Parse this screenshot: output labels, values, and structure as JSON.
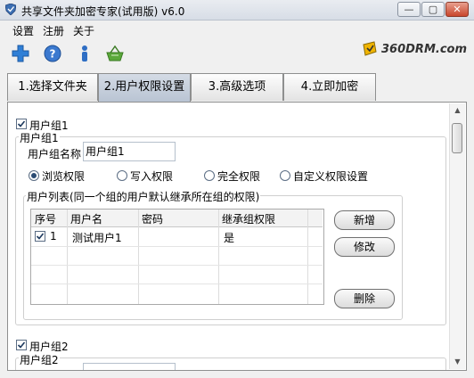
{
  "window": {
    "title": "共享文件夹加密专家(试用版) v6.0",
    "buttons": {
      "minimize": "—",
      "maximize": "▢",
      "close": "✕"
    }
  },
  "menu": [
    "设置",
    "注册",
    "关于"
  ],
  "toolbar": {
    "icons": [
      "plus-icon",
      "help-icon",
      "info-icon",
      "basket-icon"
    ],
    "brand": "360DRM.com"
  },
  "tabs": [
    {
      "label": "1.选择文件夹",
      "active": false
    },
    {
      "label": "2.用户权限设置",
      "active": true
    },
    {
      "label": "3.高级选项",
      "active": false
    },
    {
      "label": "4.立即加密",
      "active": false
    }
  ],
  "group1": {
    "checkbox_label": "用户组1",
    "checked": true,
    "frame_label": "用户组1",
    "name_label": "用户组名称",
    "name_value": "用户组1",
    "permissions": [
      "浏览权限",
      "写入权限",
      "完全权限",
      "自定义权限设置"
    ],
    "selected_permission": "浏览权限",
    "user_list_label": "用户列表(同一个组的用户默认继承所在组的权限)",
    "columns": [
      "序号",
      "用户名",
      "密码",
      "继承组权限"
    ],
    "rows": [
      {
        "checked": true,
        "index": "1",
        "user": "测试用户1",
        "password": "",
        "inherit": "是"
      }
    ],
    "buttons": {
      "add": "新增",
      "edit": "修改",
      "delete": "删除"
    }
  },
  "group2": {
    "checkbox_label": "用户组2",
    "checked": true,
    "frame_label": "用户组2"
  },
  "colors": {
    "accent": "#2b4b73",
    "tab_active": "#c3cdda"
  }
}
